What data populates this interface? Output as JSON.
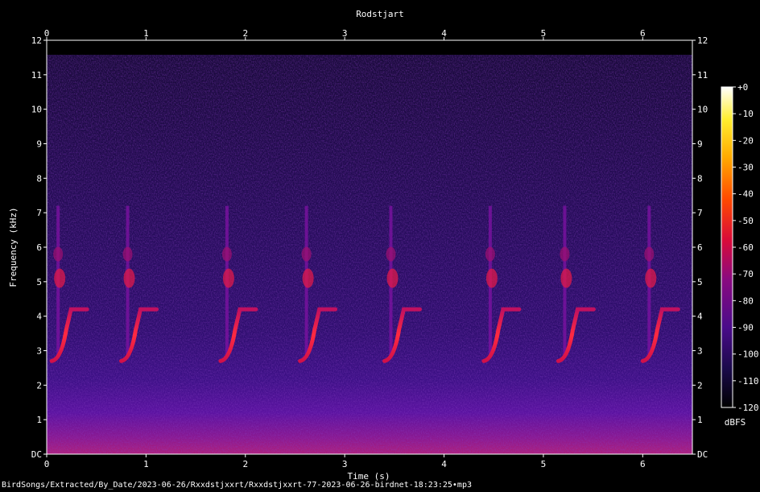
{
  "chart_data": {
    "type": "heatmap",
    "title": "Rodstjart",
    "xlabel": "Time (s)",
    "ylabel": "Frequency (kHz)",
    "x_range": [
      0,
      6.5
    ],
    "y_range": [
      0,
      12
    ],
    "x_ticks": [
      0,
      1,
      2,
      3,
      4,
      5,
      6
    ],
    "x_tick_labels": [
      "0",
      "1",
      "2",
      "3",
      "4",
      "5",
      "6"
    ],
    "y_ticks": [
      0,
      1,
      2,
      3,
      4,
      5,
      6,
      7,
      8,
      9,
      10,
      11,
      12
    ],
    "y_tick_labels": [
      "DC",
      "1",
      "2",
      "3",
      "4",
      "5",
      "6",
      "7",
      "8",
      "9",
      "10",
      "11",
      "12"
    ],
    "colorbar": {
      "label": "dBFS",
      "range": [
        -120,
        0
      ],
      "ticks": [
        0,
        -10,
        -20,
        -30,
        -40,
        -50,
        -60,
        -70,
        -80,
        -90,
        -100,
        -110,
        -120
      ],
      "tick_labels": [
        "+0",
        "-10",
        "-20",
        "-30",
        "-40",
        "-50",
        "-60",
        "-70",
        "-80",
        "-90",
        "-100",
        "-110",
        "-120"
      ],
      "colors": [
        "#000000",
        "#1a0a4a",
        "#4a0b8a",
        "#8a0a80",
        "#d80a3a",
        "#ff4a00",
        "#ffaa00",
        "#ffee30",
        "#ffffff"
      ]
    },
    "background_color": "#3a1090",
    "grid": false,
    "song_phrase_starts_s": [
      0.05,
      0.75,
      1.75,
      2.55,
      3.4,
      4.4,
      5.15,
      6.0
    ]
  },
  "footer_path": "BirdSongs/Extracted/By_Date/2023-06-26/Rxxdstjxxrt/Rxxdstjxxrt-77-2023-06-26-birdnet-18:23:25•mp3"
}
